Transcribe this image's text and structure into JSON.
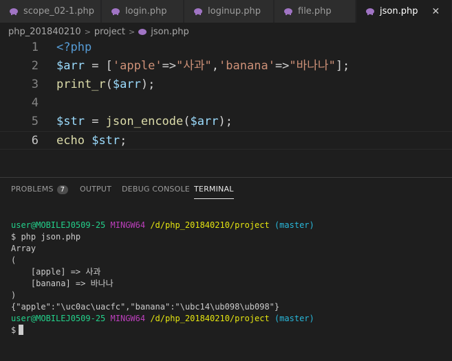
{
  "tabs": [
    {
      "label": "scope_02-1.php",
      "active": false
    },
    {
      "label": "login.php",
      "active": false
    },
    {
      "label": "loginup.php",
      "active": false
    },
    {
      "label": "file.php",
      "active": false
    },
    {
      "label": "json.php",
      "active": true
    }
  ],
  "breadcrumb": {
    "root": "php_201840210",
    "folder": "project",
    "file": "json.php",
    "sep": ">"
  },
  "editor": {
    "lines": [
      {
        "number": "1",
        "text": "<?php"
      },
      {
        "number": "2",
        "var": "$arr",
        "op": " = [",
        "k1": "'apple'",
        "arrow1": "=>",
        "v1": "\"사과\"",
        "comma": ",",
        "k2": "'banana'",
        "arrow2": "=>",
        "v2": "\"바나나\"",
        "end": "];"
      },
      {
        "number": "3",
        "fn": "print_r",
        "open": "(",
        "var": "$arr",
        "close": ");"
      },
      {
        "number": "4"
      },
      {
        "number": "5",
        "var": "$str",
        "op": " = ",
        "fn": "json_encode",
        "open": "(",
        "arg": "$arr",
        "close": ");"
      },
      {
        "number": "6",
        "kw": "echo",
        "space": " ",
        "var": "$str",
        "end": ";"
      }
    ],
    "current_line": 6
  },
  "panel": {
    "tabs": [
      "PROBLEMS",
      "OUTPUT",
      "DEBUG CONSOLE",
      "TERMINAL"
    ],
    "problems_count": "7",
    "active_tab": "TERMINAL"
  },
  "terminal": {
    "user": "user@MOBILEJ0509-25",
    "shell": "MINGW64",
    "path": "/d/php_201840210/project",
    "branch": "(master)",
    "command": "$ php json.php",
    "output": [
      "Array",
      "(",
      "    [apple] => 사과",
      "    [banana] => 바나나",
      ")",
      "{\"apple\":\"\\uc0ac\\uacfc\",\"banana\":\"\\ubc14\\ub098\\ub098\"}"
    ],
    "prompt": "$"
  },
  "colors": {
    "accent": "#a074c4",
    "background": "#1e1e1e"
  }
}
